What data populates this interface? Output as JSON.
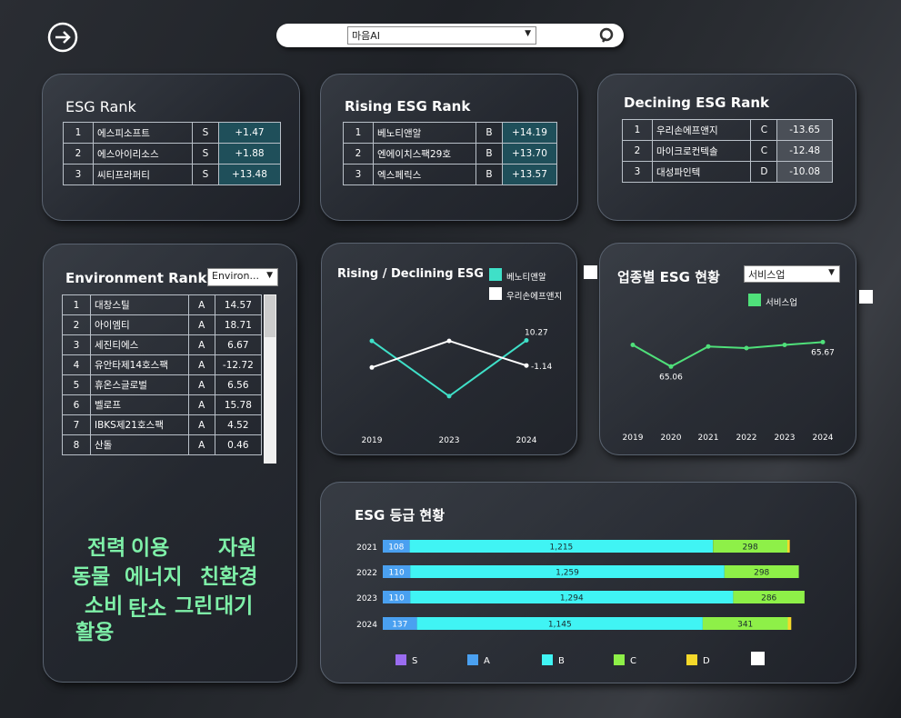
{
  "search": {
    "selected": "마음AI"
  },
  "esg_rank": {
    "title": "ESG Rank",
    "rows": [
      {
        "rank": "1",
        "name": "에스피소프트",
        "grade": "S",
        "score": "+1.47"
      },
      {
        "rank": "2",
        "name": "에스아이리소스",
        "grade": "S",
        "score": "+1.88"
      },
      {
        "rank": "3",
        "name": "씨티프라퍼티",
        "grade": "S",
        "score": "+13.48"
      }
    ]
  },
  "rising_rank": {
    "title": "Rising ESG Rank",
    "rows": [
      {
        "rank": "1",
        "name": "베노티앤알",
        "grade": "B",
        "score": "+14.19"
      },
      {
        "rank": "2",
        "name": "엔에이치스팩29호",
        "grade": "B",
        "score": "+13.70"
      },
      {
        "rank": "3",
        "name": "엑스페릭스",
        "grade": "B",
        "score": "+13.57"
      }
    ]
  },
  "declining_rank": {
    "title": "Decining ESG Rank",
    "rows": [
      {
        "rank": "1",
        "name": "우리손에프앤지",
        "grade": "C",
        "score": "-13.65"
      },
      {
        "rank": "2",
        "name": "마이크로컨텍솔",
        "grade": "C",
        "score": "-12.48"
      },
      {
        "rank": "3",
        "name": "대성파인텍",
        "grade": "D",
        "score": "-10.08"
      }
    ]
  },
  "environment_rank": {
    "title": "Environment Rank",
    "dropdown": "Environ...",
    "rows": [
      {
        "rank": "1",
        "name": "대창스틸",
        "grade": "A",
        "score": "14.57"
      },
      {
        "rank": "2",
        "name": "아이엠티",
        "grade": "A",
        "score": "18.71"
      },
      {
        "rank": "3",
        "name": "세진티에스",
        "grade": "A",
        "score": "6.67"
      },
      {
        "rank": "4",
        "name": "유안타제14호스팩",
        "grade": "A",
        "score": "-12.72"
      },
      {
        "rank": "5",
        "name": "휴온스글로벌",
        "grade": "A",
        "score": "6.56"
      },
      {
        "rank": "6",
        "name": "벨로프",
        "grade": "A",
        "score": "15.78"
      },
      {
        "rank": "7",
        "name": "IBKS제21호스팩",
        "grade": "A",
        "score": "4.52"
      },
      {
        "rank": "8",
        "name": "산돌",
        "grade": "A",
        "score": "0.46"
      }
    ],
    "word_cloud": [
      "전력",
      "이용",
      "자원",
      "동물",
      "에너지",
      "친환경",
      "소비",
      "탄소",
      "그린",
      "대기",
      "활용"
    ]
  },
  "colors": {
    "teal": "#3fe0c8",
    "green": "#4fe07a",
    "S": "#9a6cf0",
    "A": "#4aa0f0",
    "B": "#40f4f4",
    "C": "#8ef048",
    "D": "#f4d82a"
  },
  "chart_data": [
    {
      "type": "line",
      "title": "Rising / Declining ESG",
      "x": [
        "2019",
        "2023",
        "2024"
      ],
      "series": [
        {
          "name": "베노티앤알",
          "values": [
            10.0,
            -15.0,
            10.27
          ],
          "labels": [
            "",
            "",
            "10.27"
          ]
        },
        {
          "name": "우리손에프앤지",
          "values": [
            -2.0,
            10.0,
            -1.14
          ],
          "labels": [
            "",
            "",
            "-1.14"
          ]
        }
      ],
      "ylim": [
        -20,
        15
      ]
    },
    {
      "type": "line",
      "title": "업종별 ESG 현황",
      "dropdown": "서비스업",
      "x": [
        "2019",
        "2020",
        "2021",
        "2022",
        "2023",
        "2024"
      ],
      "series": [
        {
          "name": "서비스업",
          "values": [
            65.6,
            65.06,
            65.56,
            65.52,
            65.6,
            65.67
          ],
          "labels": [
            "",
            "65.06",
            "",
            "",
            "",
            "65.67"
          ]
        }
      ],
      "ylim": [
        64.5,
        66.2
      ]
    },
    {
      "type": "bar",
      "orientation": "horizontal-stacked",
      "title": "ESG 등급 현황",
      "categories": [
        "2021",
        "2022",
        "2023",
        "2024"
      ],
      "series": [
        {
          "name": "S",
          "values": [
            0,
            0,
            0,
            0
          ]
        },
        {
          "name": "A",
          "values": [
            108,
            110,
            110,
            137
          ]
        },
        {
          "name": "B",
          "values": [
            1215,
            1259,
            1294,
            1145
          ]
        },
        {
          "name": "C",
          "values": [
            298,
            298,
            286,
            341
          ]
        },
        {
          "name": "D",
          "values": [
            10,
            0,
            0,
            14
          ]
        }
      ],
      "data_labels": [
        [
          "108",
          "1,215",
          "298"
        ],
        [
          "110",
          "1,259",
          "298"
        ],
        [
          "110",
          "1,294",
          "286"
        ],
        [
          "137",
          "1,145",
          "341"
        ]
      ]
    }
  ]
}
